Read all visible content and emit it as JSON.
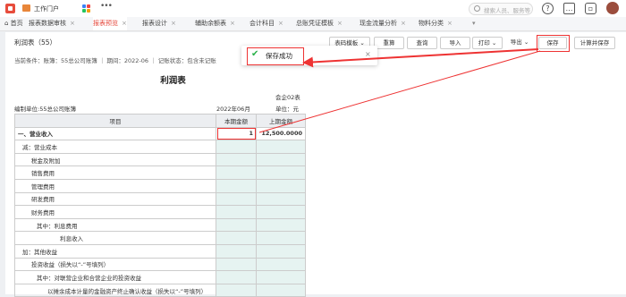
{
  "header": {
    "portal_label": "工作门户",
    "search_placeholder": "搜索人员、服务等"
  },
  "tabs": [
    {
      "label": "首页",
      "active": false,
      "closable": false
    },
    {
      "label": "报表数据审核",
      "active": false,
      "closable": true
    },
    {
      "label": "报表预览",
      "active": true,
      "closable": true
    },
    {
      "label": "报表设计",
      "active": false,
      "closable": true
    },
    {
      "label": "辅助余额表",
      "active": false,
      "closable": true
    },
    {
      "label": "会计科目",
      "active": false,
      "closable": true
    },
    {
      "label": "总账凭证模板",
      "active": false,
      "closable": true
    },
    {
      "label": "现金流量分析",
      "active": false,
      "closable": true
    },
    {
      "label": "物料分类",
      "active": false,
      "closable": true
    }
  ],
  "toolbar": {
    "title": "利润表（55）",
    "template_select": "表码模板",
    "reset": "重算",
    "query": "查询",
    "import": "导入",
    "print": "打印",
    "export": "导出",
    "save": "保存",
    "calc_save": "计算并保存"
  },
  "conditions": "当前条件：账簿：55总公司账簿 ｜ 期间：2022-06 ｜ 记账状态：包含未记账",
  "toast": {
    "message": "保存成功"
  },
  "report": {
    "title": "利润表",
    "form_no": "会企02表",
    "org": "编制单位:55总公司账簿",
    "period": "2022年06月",
    "unit": "单位：元",
    "columns": [
      "项目",
      "本期金额",
      "上期金额"
    ],
    "rows": [
      {
        "item": "一、营业收入",
        "cur": "1",
        "prev": "12,500.0000",
        "total": true
      },
      {
        "item": "减：营业成本",
        "cur": "",
        "prev": "",
        "indent": 1
      },
      {
        "item": "税金及附加",
        "cur": "",
        "prev": "",
        "indent": 2
      },
      {
        "item": "销售费用",
        "cur": "",
        "prev": "",
        "indent": 2
      },
      {
        "item": "管理费用",
        "cur": "",
        "prev": "",
        "indent": 2
      },
      {
        "item": "研发费用",
        "cur": "",
        "prev": "",
        "indent": 2
      },
      {
        "item": "财务费用",
        "cur": "",
        "prev": "",
        "indent": 2
      },
      {
        "item": "其中：利息费用",
        "cur": "",
        "prev": "",
        "indent": 3
      },
      {
        "item": "利息收入",
        "cur": "",
        "prev": "",
        "indent": 4
      },
      {
        "item": "加：其他收益",
        "cur": "",
        "prev": "",
        "indent": 1
      },
      {
        "item": "投资收益（损失以“-”号填列）",
        "cur": "",
        "prev": "",
        "indent": 2
      },
      {
        "item": "其中：对联营企业和合营企业的投资收益",
        "cur": "",
        "prev": "",
        "indent": 3
      },
      {
        "item": "以摊余成本计量的金融资产终止确认收益（损失以“-”号填列）",
        "cur": "",
        "prev": "",
        "indent": 5
      }
    ]
  },
  "colors": {
    "accent": "#e5483c",
    "annotation_red": "#e33333",
    "input_cell": "#e6f3f1",
    "success": "#2ab24a"
  }
}
